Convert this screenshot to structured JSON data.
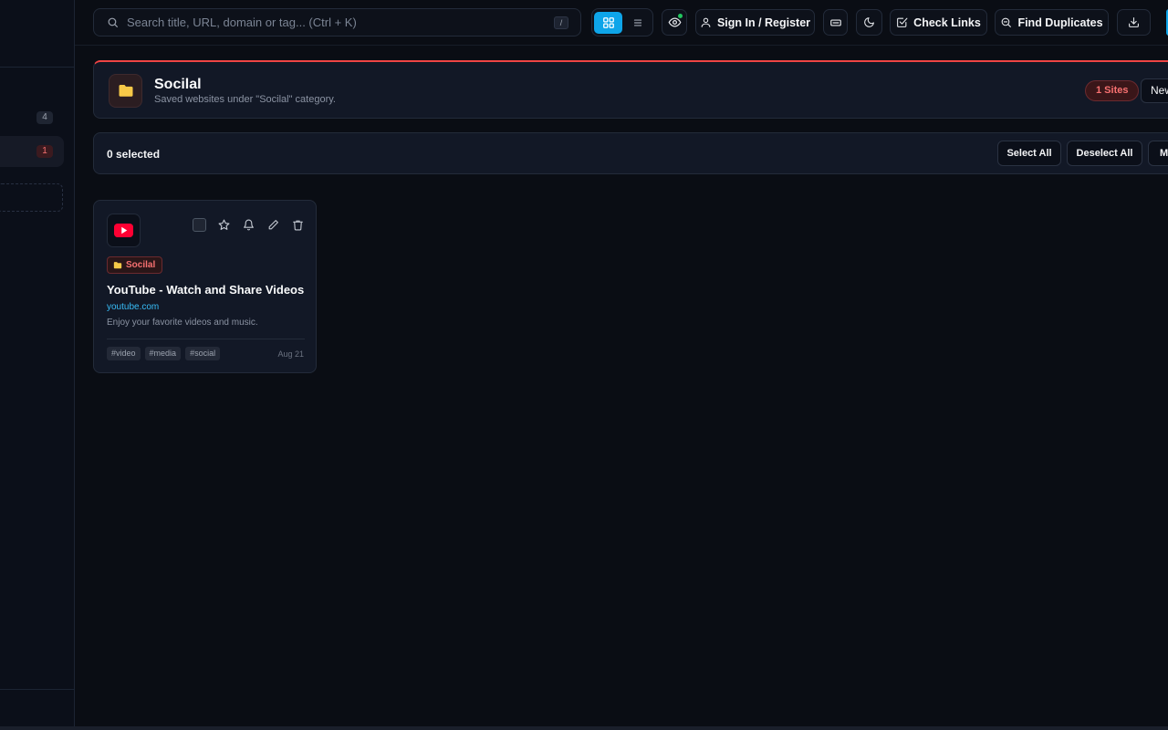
{
  "search": {
    "placeholder": "Search title, URL, domain or tag... (Ctrl + K)",
    "shortcut": "/"
  },
  "toolbar": {
    "view_modes": [
      {
        "name": "grid",
        "icon": "grid-icon",
        "active": true
      },
      {
        "name": "list",
        "icon": "list-icon",
        "active": false
      }
    ],
    "signin_label": "Sign In / Register",
    "check_links_label": "Check Links",
    "find_duplicates_label": "Find Duplicates"
  },
  "sidebar": {
    "items": [
      {
        "count": "4"
      },
      {
        "count": "1",
        "active": true
      }
    ]
  },
  "category": {
    "title": "Socilal",
    "subtitle": "Saved websites under \"Socilal\" category.",
    "sites_badge": "1 Sites",
    "new_label": "New"
  },
  "selection": {
    "count_label": "0 selected",
    "select_all_label": "Select All",
    "deselect_all_label": "Deselect All",
    "more_label": "M"
  },
  "cards": [
    {
      "category": "Socilal",
      "title": "YouTube - Watch and Share Videos",
      "domain": "youtube.com",
      "description": "Enjoy your favorite videos and music.",
      "tags": [
        "#video",
        "#media",
        "#social"
      ],
      "date": "Aug 21"
    }
  ],
  "colors": {
    "accent": "#0ea5e9",
    "category": "#ef4444",
    "folder": "#f7c948",
    "background": "#0a0d14",
    "panel": "#121826"
  }
}
